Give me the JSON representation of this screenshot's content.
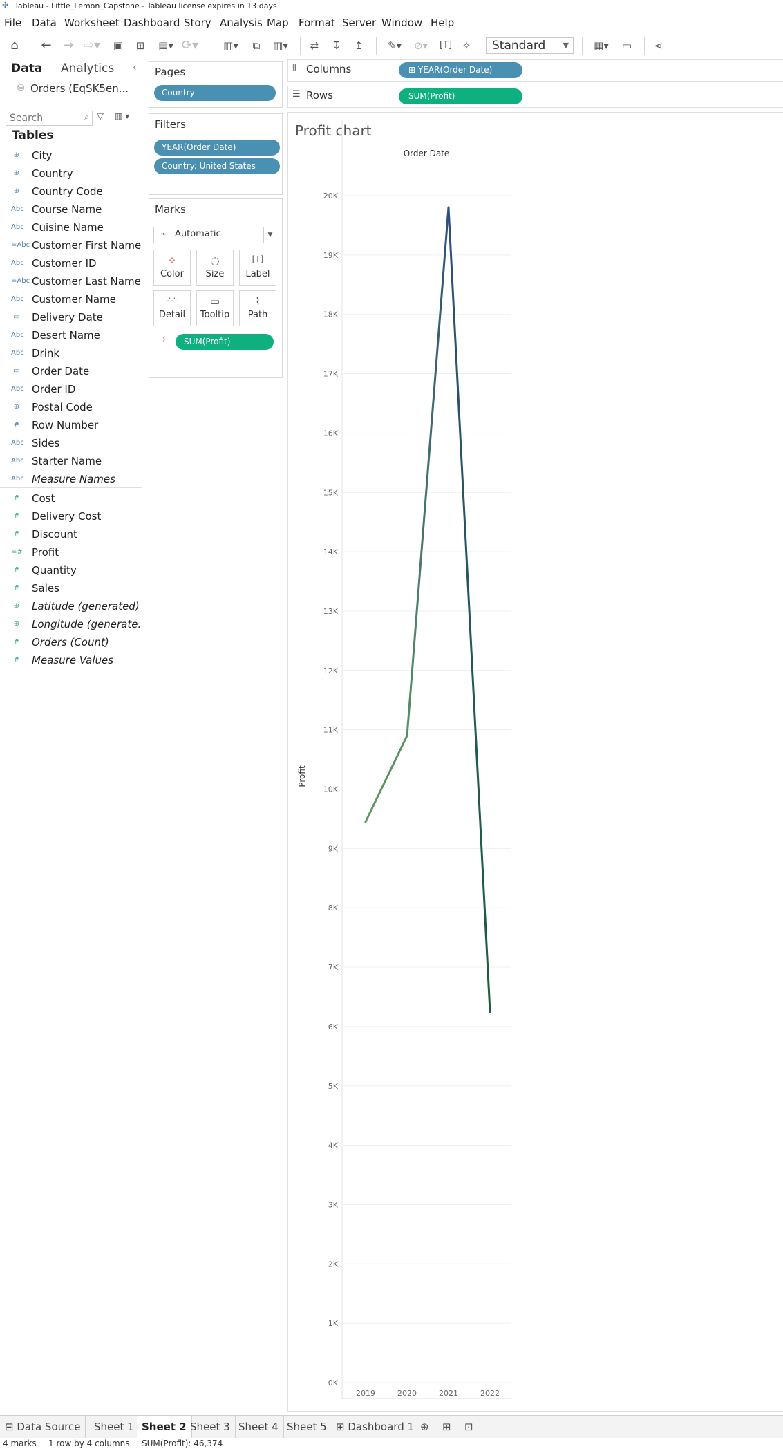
{
  "window": {
    "title": "Tableau - Little_Lemon_Capstone - Tableau license expires in 13 days"
  },
  "menu": [
    "File",
    "Data",
    "Worksheet",
    "Dashboard",
    "Story",
    "Analysis",
    "Map",
    "Format",
    "Server",
    "Window",
    "Help"
  ],
  "toolbar": {
    "presentation_select": "Standard"
  },
  "data_pane": {
    "tabs": {
      "data": "Data",
      "analytics": "Analytics"
    },
    "datasource": "Orders (EqSK5en...",
    "search_placeholder": "Search",
    "tables_heading": "Tables",
    "dimensions": [
      {
        "icon": "⊕",
        "label": "City"
      },
      {
        "icon": "⊕",
        "label": "Country"
      },
      {
        "icon": "⊕",
        "label": "Country Code"
      },
      {
        "icon": "Abc",
        "label": "Course Name"
      },
      {
        "icon": "Abc",
        "label": "Cuisine Name"
      },
      {
        "icon": "=Abc",
        "label": "Customer First Name"
      },
      {
        "icon": "Abc",
        "label": "Customer ID"
      },
      {
        "icon": "=Abc",
        "label": "Customer Last Name"
      },
      {
        "icon": "Abc",
        "label": "Customer Name"
      },
      {
        "icon": "▭",
        "label": "Delivery Date"
      },
      {
        "icon": "Abc",
        "label": "Desert Name"
      },
      {
        "icon": "Abc",
        "label": "Drink"
      },
      {
        "icon": "▭",
        "label": "Order Date"
      },
      {
        "icon": "Abc",
        "label": "Order ID"
      },
      {
        "icon": "⊕",
        "label": "Postal Code"
      },
      {
        "icon": "#",
        "label": "Row Number"
      },
      {
        "icon": "Abc",
        "label": "Sides"
      },
      {
        "icon": "Abc",
        "label": "Starter Name"
      },
      {
        "icon": "Abc",
        "label": "Measure Names",
        "italic": true
      }
    ],
    "measures": [
      {
        "icon": "#",
        "label": "Cost"
      },
      {
        "icon": "#",
        "label": "Delivery Cost"
      },
      {
        "icon": "#",
        "label": "Discount"
      },
      {
        "icon": "=#",
        "label": "Profit"
      },
      {
        "icon": "#",
        "label": "Quantity"
      },
      {
        "icon": "#",
        "label": "Sales"
      },
      {
        "icon": "⊕",
        "label": "Latitude (generated)",
        "italic": true
      },
      {
        "icon": "⊕",
        "label": "Longitude (generate...",
        "italic": true
      },
      {
        "icon": "#",
        "label": "Orders (Count)",
        "italic": true
      },
      {
        "icon": "#",
        "label": "Measure Values",
        "italic": true
      }
    ]
  },
  "cards": {
    "pages": {
      "title": "Pages",
      "pill": "Country"
    },
    "filters": {
      "title": "Filters",
      "pills": [
        "YEAR(Order Date)",
        "Country: United States"
      ]
    },
    "marks": {
      "title": "Marks",
      "type": "Automatic",
      "buttons": [
        "Color",
        "Size",
        "Label",
        "Detail",
        "Tooltip",
        "Path"
      ],
      "pill": "SUM(Profit)"
    }
  },
  "shelves": {
    "columns": {
      "label": "Columns",
      "pill": "⊞ YEAR(Order Date)"
    },
    "rows": {
      "label": "Rows",
      "pill": "SUM(Profit)"
    }
  },
  "sheet": {
    "title": "Profit chart"
  },
  "chart_data": {
    "type": "line",
    "xlabel": "Order Date",
    "ylabel": "Profit",
    "categories": [
      "2019",
      "2020",
      "2021",
      "2022"
    ],
    "series": [
      {
        "values": [
          9450,
          10900,
          19800,
          6250
        ]
      }
    ],
    "ylim": [
      0,
      20000
    ],
    "yticks": [
      0,
      1000,
      2000,
      3000,
      4000,
      5000,
      6000,
      7000,
      8000,
      9000,
      10000,
      11000,
      12000,
      13000,
      14000,
      15000,
      16000,
      17000,
      18000,
      19000,
      20000
    ],
    "ytick_labels": [
      "0K",
      "1K",
      "2K",
      "3K",
      "4K",
      "5K",
      "6K",
      "7K",
      "8K",
      "9K",
      "10K",
      "11K",
      "12K",
      "13K",
      "14K",
      "15K",
      "16K",
      "17K",
      "18K",
      "19K",
      "20K"
    ],
    "grid": true,
    "colors": {
      "low": "#6ab255",
      "high": "#2f4f7c",
      "end": "#1b5e3c"
    }
  },
  "sheet_tabs": [
    {
      "label": "⊟ Data Source"
    },
    {
      "label": "Sheet 1"
    },
    {
      "label": "Sheet 2",
      "active": true
    },
    {
      "label": "Sheet 3"
    },
    {
      "label": "Sheet 4"
    },
    {
      "label": "Sheet 5"
    },
    {
      "label": "⊞ Dashboard 1"
    }
  ],
  "status": {
    "marks": "4 marks",
    "rows": "1 row by 4 columns",
    "sum": "SUM(Profit): 46,374"
  }
}
